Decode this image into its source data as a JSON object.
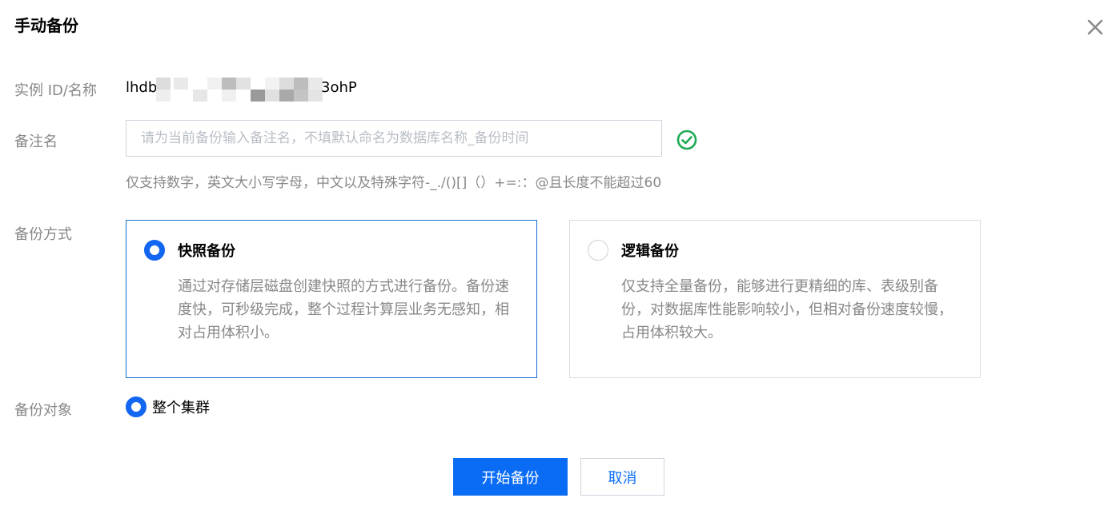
{
  "dialog": {
    "title": "手动备份",
    "close_icon": "close-icon"
  },
  "instance": {
    "label": "实例 ID/名称",
    "id_prefix": "lhdb",
    "id_suffix": "3ohP"
  },
  "remark": {
    "label": "备注名",
    "placeholder": "请为当前备份输入备注名，不填默认命名为数据库名称_备份时间",
    "value": "",
    "status_icon": "check-circle-icon",
    "status_color": "#1eaa56",
    "hint": "仅支持数字，英文大小写字母，中文以及特殊字符-_./()[]（）+=:：@且长度不能超过60"
  },
  "backup_method": {
    "label": "备份方式",
    "options": [
      {
        "title": "快照备份",
        "description": "通过对存储层磁盘创建快照的方式进行备份。备份速度快，可秒级完成，整个过程计算层业务无感知，相对占用体积小。",
        "selected": true
      },
      {
        "title": "逻辑备份",
        "description": "仅支持全量备份，能够进行更精细的库、表级别备份，对数据库性能影响较小，但相对备份速度较慢，占用体积较大。",
        "selected": false
      }
    ]
  },
  "backup_target": {
    "label": "备份对象",
    "option": "整个集群",
    "selected": true
  },
  "buttons": {
    "start": "开始备份",
    "cancel": "取消"
  },
  "colors": {
    "primary": "#0a6cf5",
    "selected_border": "#1a6fd6",
    "label_gray": "#888888"
  }
}
